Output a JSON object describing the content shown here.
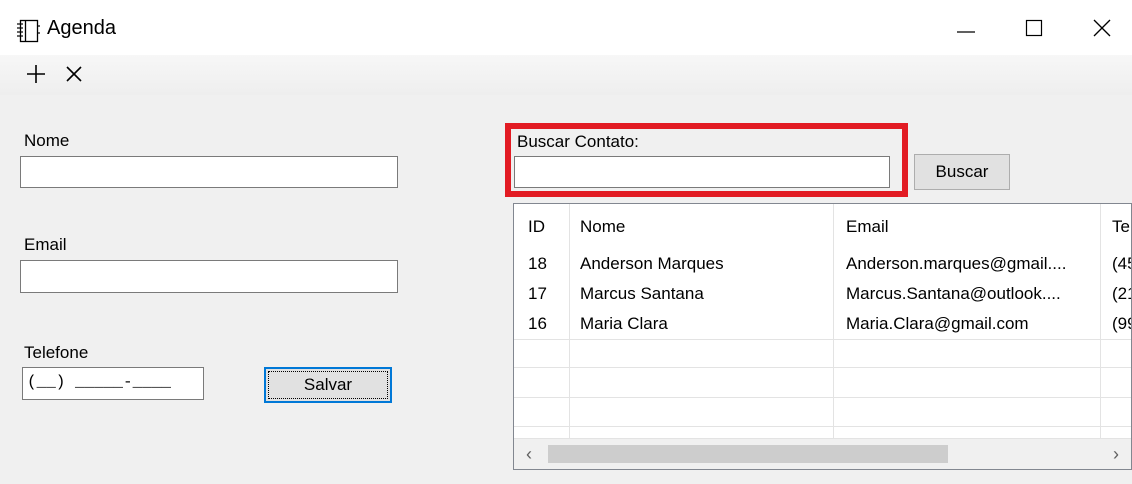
{
  "window": {
    "title": "Agenda",
    "icon": "notebook-icon",
    "controls": {
      "minimize": "minimize-icon",
      "maximize": "maximize-icon",
      "close": "close-icon"
    }
  },
  "toolbar": {
    "add_icon": "plus-icon",
    "remove_icon": "x-icon"
  },
  "form": {
    "nome_label": "Nome",
    "nome_value": "",
    "email_label": "Email",
    "email_value": "",
    "telefone_label": "Telefone",
    "telefone_value": "(__) _____-____",
    "save_label": "Salvar"
  },
  "search": {
    "label": "Buscar Contato:",
    "value": "",
    "button_label": "Buscar",
    "highlight_color": "#e21b23"
  },
  "table": {
    "columns": [
      "ID",
      "Nome",
      "Email",
      "Tel"
    ],
    "rows": [
      {
        "id": "18",
        "nome": "Anderson Marques",
        "email": "Anderson.marques@gmail....",
        "tel": "(45"
      },
      {
        "id": "17",
        "nome": "Marcus Santana",
        "email": "Marcus.Santana@outlook....",
        "tel": "(21"
      },
      {
        "id": "16",
        "nome": "Maria Clara",
        "email": "Maria.Clara@gmail.com",
        "tel": "(99"
      }
    ],
    "scroll_left_icon": "chevron-left-icon",
    "scroll_right_icon": "chevron-right-icon"
  }
}
